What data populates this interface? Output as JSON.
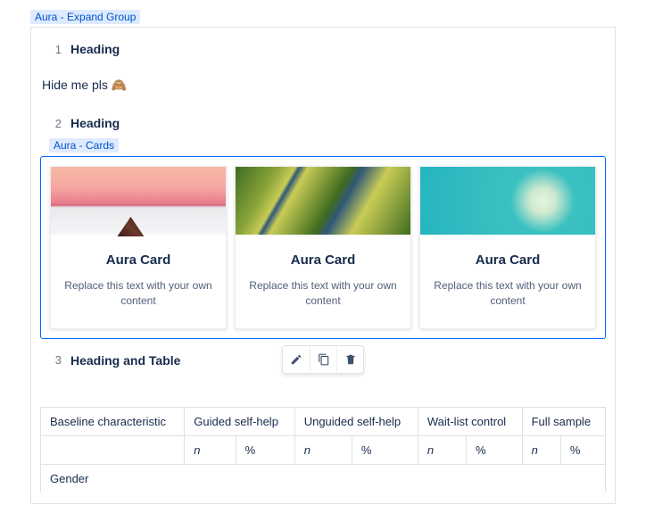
{
  "breadcrumb_expand": "Aura - Expand Group",
  "breadcrumb_cards": "Aura - Cards",
  "headings": {
    "h1": {
      "num": "1",
      "label": "Heading"
    },
    "h2": {
      "num": "2",
      "label": "Heading"
    },
    "h3": {
      "num": "3",
      "label": "Heading and Table"
    }
  },
  "hide_text": "Hide me pls 🙈",
  "cards": [
    {
      "title": "Aura Card",
      "text": "Replace this text with your own content"
    },
    {
      "title": "Aura Card",
      "text": "Replace this text with your own content"
    },
    {
      "title": "Aura Card",
      "text": "Replace this text with your own content"
    }
  ],
  "table": {
    "row1": {
      "c0": "Baseline characteristic",
      "c1": "Guided self-help",
      "c2": "Unguided self-help",
      "c3": "Wait-list control",
      "c4": "Full sample"
    },
    "row2": {
      "n": "n",
      "pct": "%"
    },
    "row3": {
      "c0": "Gender"
    }
  }
}
